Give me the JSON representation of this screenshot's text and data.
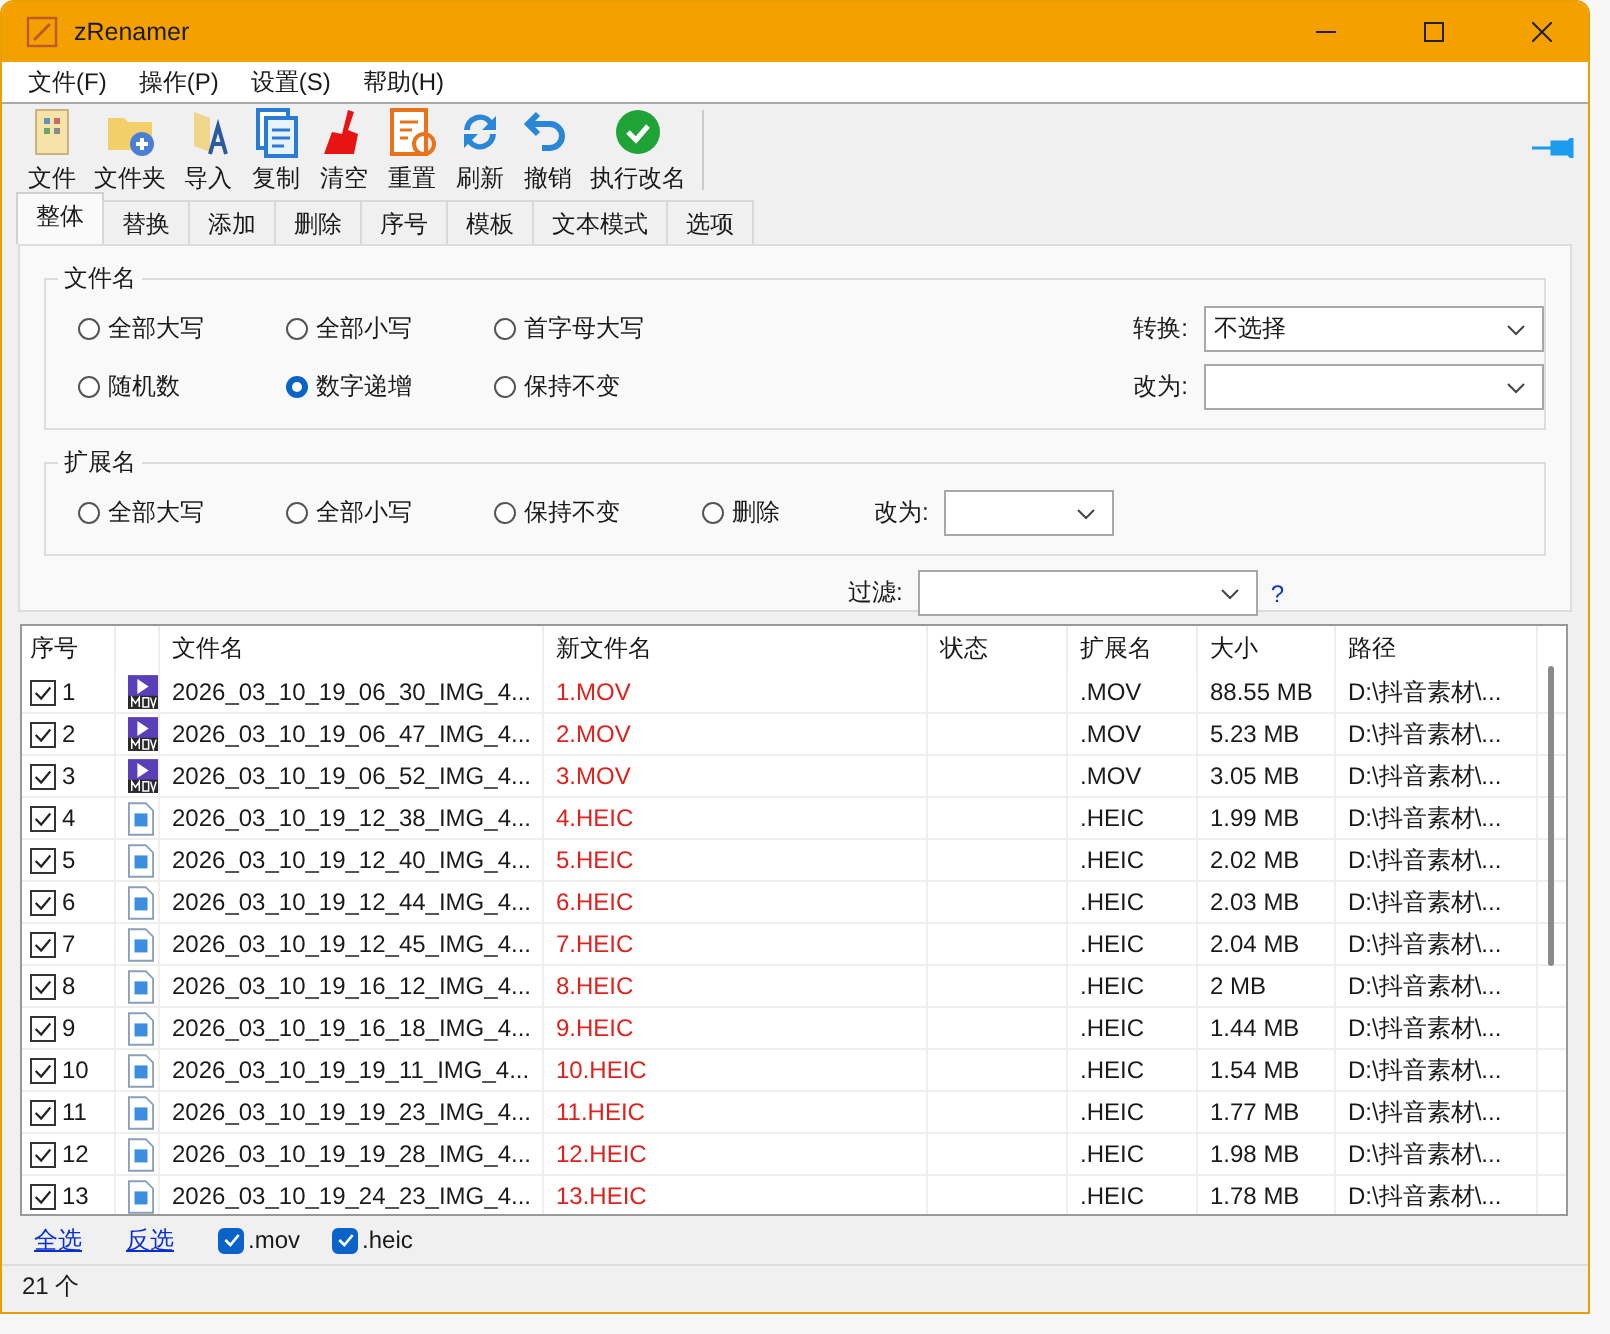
{
  "window": {
    "title": "zRenamer"
  },
  "menu": [
    "文件(F)",
    "操作(P)",
    "设置(S)",
    "帮助(H)"
  ],
  "toolbar": [
    {
      "kind": "file",
      "label": "文件"
    },
    {
      "kind": "folder",
      "label": "文件夹"
    },
    {
      "kind": "import",
      "label": "导入"
    },
    {
      "kind": "copy",
      "label": "复制"
    },
    {
      "kind": "clear",
      "label": "清空"
    },
    {
      "kind": "reset",
      "label": "重置"
    },
    {
      "kind": "refresh",
      "label": "刷新"
    },
    {
      "kind": "undo",
      "label": "撤销"
    },
    {
      "kind": "run",
      "label": "执行改名"
    }
  ],
  "tabs": [
    {
      "label": "整体",
      "selected": true
    },
    {
      "label": "替换",
      "selected": false
    },
    {
      "label": "添加",
      "selected": false
    },
    {
      "label": "删除",
      "selected": false
    },
    {
      "label": "序号",
      "selected": false
    },
    {
      "label": "模板",
      "selected": false
    },
    {
      "label": "文本模式",
      "selected": false
    },
    {
      "label": "选项",
      "selected": false
    }
  ],
  "filename_group": {
    "title": "文件名",
    "options": [
      {
        "label": "全部大写",
        "selected": false
      },
      {
        "label": "全部小写",
        "selected": false
      },
      {
        "label": "首字母大写",
        "selected": false
      },
      {
        "label": "随机数",
        "selected": false
      },
      {
        "label": "数字递增",
        "selected": true
      },
      {
        "label": "保持不变",
        "selected": false
      }
    ],
    "convert": {
      "label": "转换:",
      "value": "不选择"
    },
    "change_to": {
      "label": "改为:"
    }
  },
  "extension_group": {
    "title": "扩展名",
    "options": [
      {
        "label": "全部大写",
        "selected": false
      },
      {
        "label": "全部小写",
        "selected": false
      },
      {
        "label": "保持不变",
        "selected": false
      },
      {
        "label": "删除",
        "selected": false
      }
    ],
    "change_to": {
      "label": "改为:"
    }
  },
  "filter": {
    "label": "过滤:",
    "help": "?"
  },
  "table": {
    "columns": [
      "序号",
      "文件名",
      "新文件名",
      "状态",
      "扩展名",
      "大小",
      "路径"
    ],
    "rows": [
      {
        "checked": true,
        "index": "1",
        "kind": "mov",
        "name": "2026_03_10_19_06_30_IMG_4...",
        "new_name": "1.MOV",
        "ext": ".MOV",
        "size": "88.55 MB",
        "path": "D:\\抖音素材\\..."
      },
      {
        "checked": true,
        "index": "2",
        "kind": "mov",
        "name": "2026_03_10_19_06_47_IMG_4...",
        "new_name": "2.MOV",
        "ext": ".MOV",
        "size": "5.23 MB",
        "path": "D:\\抖音素材\\..."
      },
      {
        "checked": true,
        "index": "3",
        "kind": "mov",
        "name": "2026_03_10_19_06_52_IMG_4...",
        "new_name": "3.MOV",
        "ext": ".MOV",
        "size": "3.05 MB",
        "path": "D:\\抖音素材\\..."
      },
      {
        "checked": true,
        "index": "4",
        "kind": "image",
        "name": "2026_03_10_19_12_38_IMG_4...",
        "new_name": "4.HEIC",
        "ext": ".HEIC",
        "size": "1.99 MB",
        "path": "D:\\抖音素材\\..."
      },
      {
        "checked": true,
        "index": "5",
        "kind": "image",
        "name": "2026_03_10_19_12_40_IMG_4...",
        "new_name": "5.HEIC",
        "ext": ".HEIC",
        "size": "2.02 MB",
        "path": "D:\\抖音素材\\..."
      },
      {
        "checked": true,
        "index": "6",
        "kind": "image",
        "name": "2026_03_10_19_12_44_IMG_4...",
        "new_name": "6.HEIC",
        "ext": ".HEIC",
        "size": "2.03 MB",
        "path": "D:\\抖音素材\\..."
      },
      {
        "checked": true,
        "index": "7",
        "kind": "image",
        "name": "2026_03_10_19_12_45_IMG_4...",
        "new_name": "7.HEIC",
        "ext": ".HEIC",
        "size": "2.04 MB",
        "path": "D:\\抖音素材\\..."
      },
      {
        "checked": true,
        "index": "8",
        "kind": "image",
        "name": "2026_03_10_19_16_12_IMG_4...",
        "new_name": "8.HEIC",
        "ext": ".HEIC",
        "size": "2 MB",
        "path": "D:\\抖音素材\\..."
      },
      {
        "checked": true,
        "index": "9",
        "kind": "image",
        "name": "2026_03_10_19_16_18_IMG_4...",
        "new_name": "9.HEIC",
        "ext": ".HEIC",
        "size": "1.44 MB",
        "path": "D:\\抖音素材\\..."
      },
      {
        "checked": true,
        "index": "10",
        "kind": "image",
        "name": "2026_03_10_19_19_11_IMG_4...",
        "new_name": "10.HEIC",
        "ext": ".HEIC",
        "size": "1.54 MB",
        "path": "D:\\抖音素材\\..."
      },
      {
        "checked": true,
        "index": "11",
        "kind": "image",
        "name": "2026_03_10_19_19_23_IMG_4...",
        "new_name": "11.HEIC",
        "ext": ".HEIC",
        "size": "1.77 MB",
        "path": "D:\\抖音素材\\..."
      },
      {
        "checked": true,
        "index": "12",
        "kind": "image",
        "name": "2026_03_10_19_19_28_IMG_4...",
        "new_name": "12.HEIC",
        "ext": ".HEIC",
        "size": "1.98 MB",
        "path": "D:\\抖音素材\\..."
      },
      {
        "checked": true,
        "index": "13",
        "kind": "image",
        "name": "2026_03_10_19_24_23_IMG_4...",
        "new_name": "13.HEIC",
        "ext": ".HEIC",
        "size": "1.78 MB",
        "path": "D:\\抖音素材\\..."
      }
    ]
  },
  "footer": {
    "links": [
      "全选",
      "反选"
    ],
    "type_filters": [
      {
        "label": ".mov",
        "checked": true
      },
      {
        "label": ".heic",
        "checked": true
      }
    ]
  },
  "status_bar": {
    "count": "21 个"
  }
}
